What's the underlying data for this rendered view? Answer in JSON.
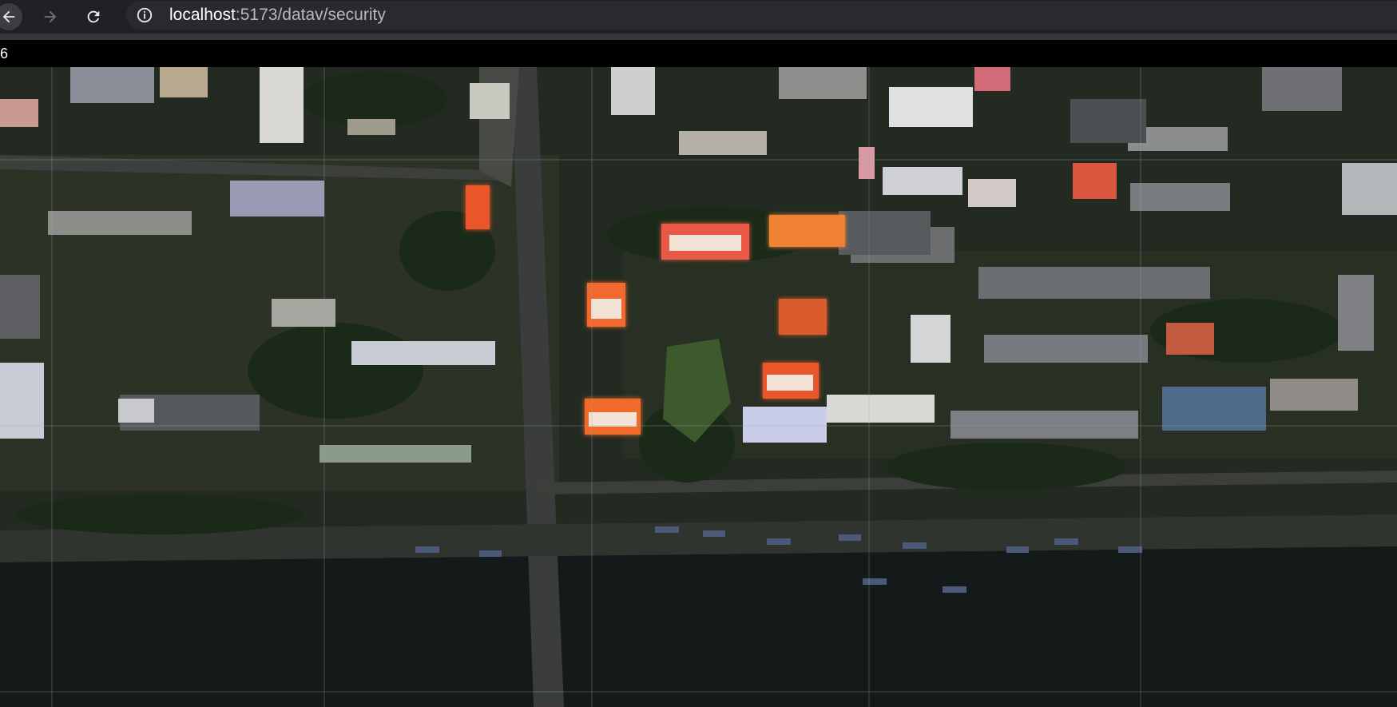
{
  "browser": {
    "url_host": "localhost",
    "url_path": ":5173/datav/security"
  },
  "page": {
    "counter_text": "6"
  },
  "map": {
    "type": "satellite-imagery",
    "grid": true,
    "highlight_color": "#e8572a"
  },
  "icons": {
    "back": "back-arrow-icon",
    "forward": "forward-arrow-icon",
    "reload": "reload-icon",
    "site_info": "info-icon"
  }
}
